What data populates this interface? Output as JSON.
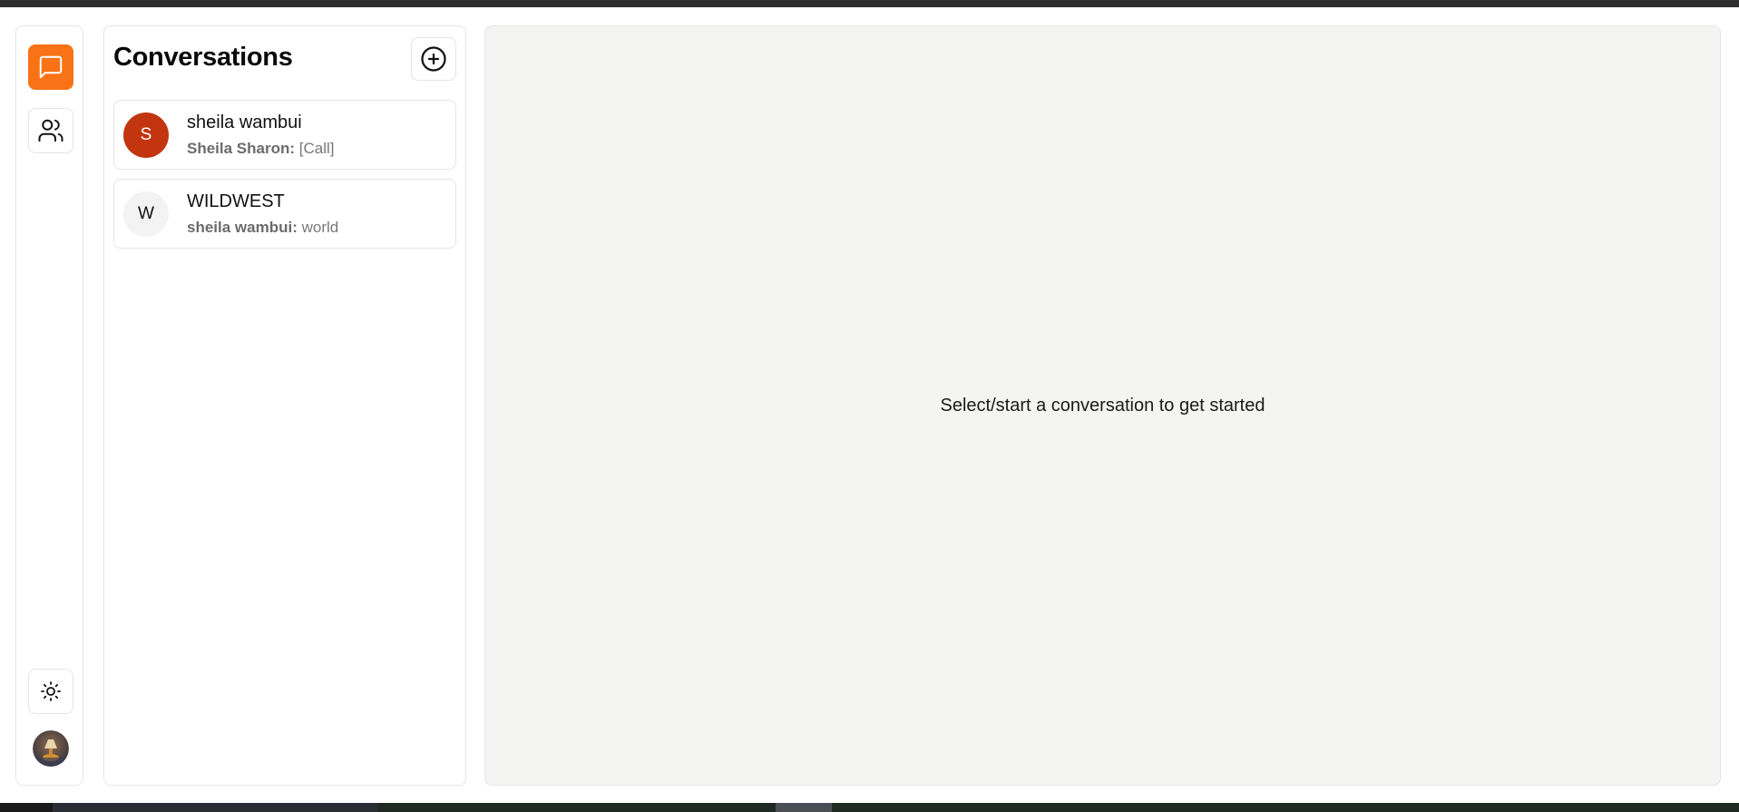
{
  "rail": {
    "items": [
      {
        "name": "chats",
        "icon": "message-square-icon",
        "active": true
      },
      {
        "name": "contacts",
        "icon": "users-icon",
        "active": false
      }
    ],
    "theme_icon": "sun-icon",
    "accent_color": "#f97316"
  },
  "conversations": {
    "title": "Conversations",
    "new_icon": "plus-circle-icon",
    "items": [
      {
        "initial": "S",
        "name": "sheila wambui",
        "sender": "Sheila Sharon:",
        "message": "[Call]",
        "avatar_color": "#c2350f",
        "avatar_text_color": "#ffffff"
      },
      {
        "initial": "W",
        "name": "WILDWEST",
        "sender": "sheila wambui:",
        "message": "world",
        "avatar_color": "#f3f3f3",
        "avatar_text_color": "#111111"
      }
    ]
  },
  "main": {
    "empty_message": "Select/start a conversation to get started"
  }
}
